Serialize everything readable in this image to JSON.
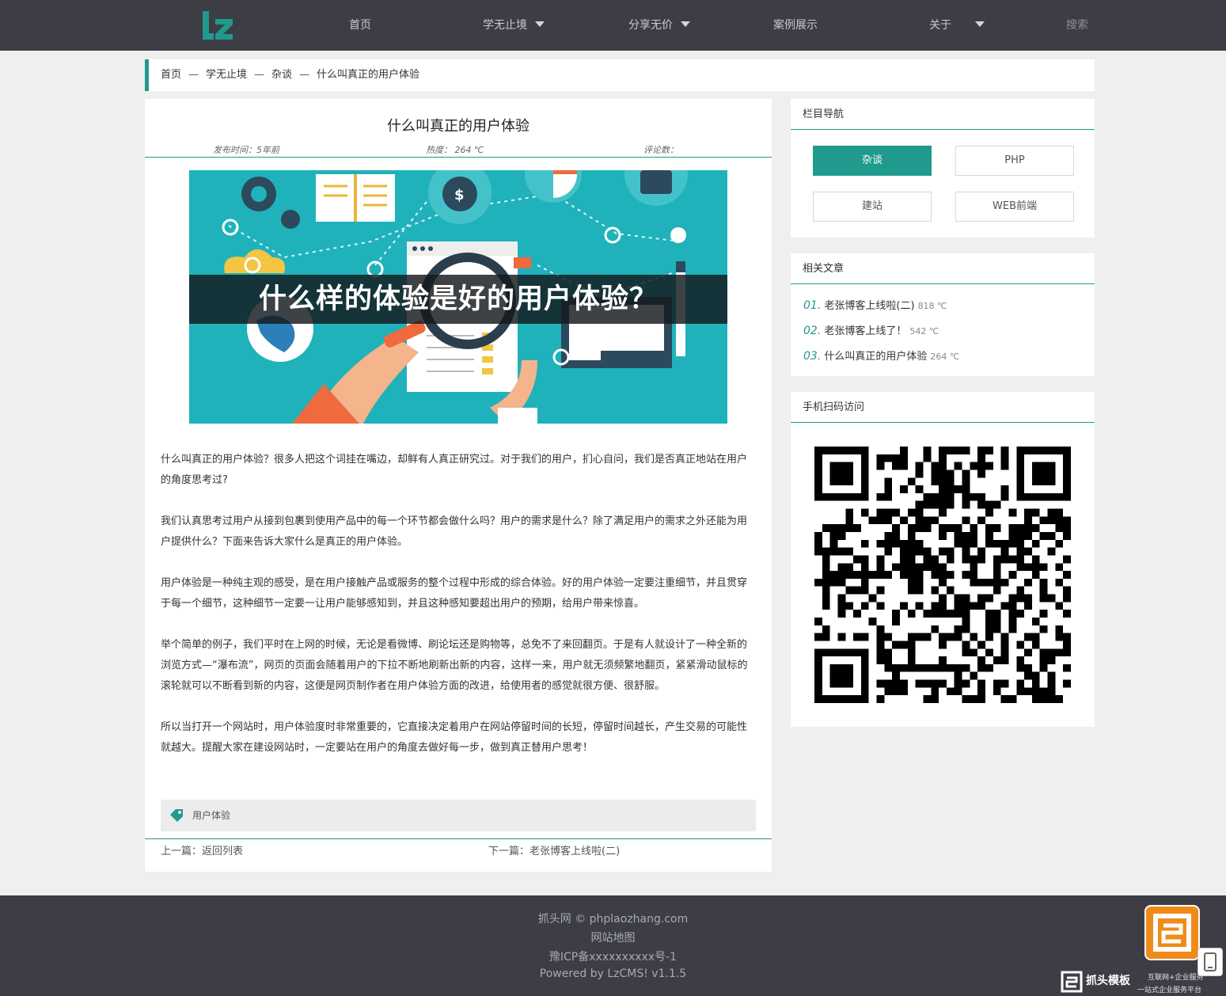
{
  "nav": {
    "logo_text": "LZ",
    "items": [
      {
        "label": "首页",
        "dropdown": false
      },
      {
        "label": "学无止境",
        "dropdown": true
      },
      {
        "label": "分享无价",
        "dropdown": true
      },
      {
        "label": "案例展示",
        "dropdown": false
      },
      {
        "label": "关于",
        "dropdown": true
      }
    ],
    "search_label": "搜索"
  },
  "breadcrumb": {
    "items": [
      "首页",
      "学无止境",
      "杂谈",
      "什么叫真正的用户体验"
    ],
    "separator": "—"
  },
  "article": {
    "title": "什么叫真正的用户体验",
    "meta": {
      "publish": "发布时间：5年前",
      "heat": "热度： 264 ℃",
      "comments": "评论数："
    },
    "hero_caption": "什么样的体验是好的用户体验？",
    "paragraphs": [
      "什么叫真正的用户体验？很多人把这个词挂在嘴边，却鲜有人真正研究过。对于我们的用户，扪心自问，我们是否真正地站在用户的角度思考过?",
      "我们认真思考过用户从接到包裹到使用产品中的每一个环节都会做什么吗？用户的需求是什么？除了满足用户的需求之外还能为用户提供什么？下面来告诉大家什么是真正的用户体验。",
      "用户体验是一种纯主观的感受，是在用户接触产品或服务的整个过程中形成的综合体验。好的用户体验一定要注重细节，并且贯穿于每一个细节，这种细节一定要一让用户能够感知到，并且这种感知要超出用户的预期，给用户带来惊喜。",
      "举个简单的例子，我们平时在上网的时候，无论是看微博、刷论坛还是购物等，总免不了来回翻页。于是有人就设计了一种全新的浏览方式—“瀑布流”，网页的页面会随着用户的下拉不断地刷新出新的内容，这样一来，用户就无须频繁地翻页，紧紧滑动鼠标的滚轮就可以不断看到新的内容，这便是网页制作者在用户体验方面的改进，给使用者的感觉就很方便、很舒服。",
      "所以当打开一个网站时，用户体验度时非常重要的，它直接决定着用户在网站停留时间的长短，停留时间越长，产生交易的可能性就越大。提醒大家在建设网站时，一定要站在用户的角度去做好每一步，做到真正替用户思考！"
    ],
    "tag": "用户体验",
    "prev": "上一篇：返回列表",
    "next": "下一篇：老张博客上线啦(二)"
  },
  "sidebar": {
    "categories": {
      "title": "栏目导航",
      "items": [
        {
          "label": "杂谈",
          "active": true
        },
        {
          "label": "PHP",
          "active": false
        },
        {
          "label": "建站",
          "active": false
        },
        {
          "label": "WEB前端",
          "active": false
        }
      ]
    },
    "related": {
      "title": "相关文章",
      "items": [
        {
          "num": "01.",
          "title": "老张博客上线啦(二)",
          "heat": "818 ℃"
        },
        {
          "num": "02.",
          "title": "老张博客上线了！",
          "heat": "542 ℃"
        },
        {
          "num": "03.",
          "title": "什么叫真正的用户体验",
          "heat": "264 ℃"
        }
      ]
    },
    "qr": {
      "title": "手机扫码访问"
    }
  },
  "footer": {
    "copyright": "抓头网 ©  phplaozhang.com",
    "sitemap": "网站地图",
    "icp": "豫ICP备xxxxxxxxxx号-1",
    "powered": "Powered by LzCMS! v1.1.5"
  },
  "watermark": {
    "brand": "抓头模板",
    "sub1": "互联网+企业服务",
    "sub2": "一站式企业服务平台"
  },
  "colors": {
    "accent": "#1f9a8c",
    "header_bg": "#3c3d45",
    "page_bg": "#efefef",
    "badge": "#f08b1a"
  }
}
